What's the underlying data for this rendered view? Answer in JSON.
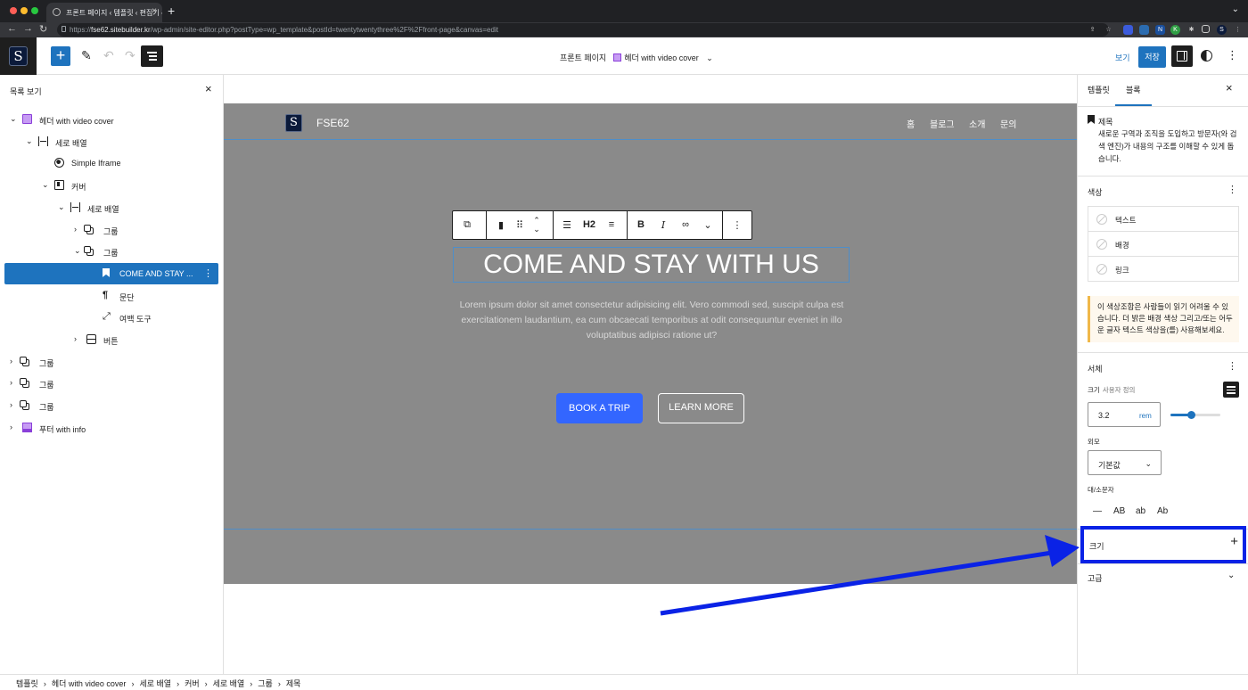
{
  "browser": {
    "tab_title": "프론트 페이지 ‹ 템플릿 ‹ 편집기 ‹ F",
    "url_prefix": "https://",
    "url_host": "fse62.sitebuilder.kr",
    "url_path": "/wp-admin/site-editor.php?postType=wp_template&postId=twentytwentythree%2F%2Ffront-page&canvas=edit"
  },
  "topbar": {
    "logo_letter": "S",
    "doc_title": "프론트 페이지",
    "template_name": "헤더 with video cover",
    "view_label": "보기",
    "save_label": "저장"
  },
  "list_view": {
    "title": "목록 보기",
    "items": [
      {
        "label": "헤더 with video cover",
        "indent": 0,
        "chevron": "⌄",
        "icon": "template"
      },
      {
        "label": "세로 배열",
        "indent": 1,
        "chevron": "⌄",
        "icon": "stack"
      },
      {
        "label": "Simple Iframe",
        "indent": 2,
        "chevron": "",
        "icon": "globe"
      },
      {
        "label": "커버",
        "indent": 2,
        "chevron": "⌄",
        "icon": "cover"
      },
      {
        "label": "세로 배열",
        "indent": 3,
        "chevron": "⌄",
        "icon": "stack"
      },
      {
        "label": "그룹",
        "indent": 4,
        "chevron": "›",
        "icon": "group"
      },
      {
        "label": "그룹",
        "indent": 4,
        "chevron": "⌄",
        "icon": "group"
      },
      {
        "label": "COME AND STAY ...",
        "indent": 5,
        "chevron": "",
        "icon": "bookmark",
        "selected": true
      },
      {
        "label": "문단",
        "indent": 5,
        "chevron": "",
        "icon": "paragraph"
      },
      {
        "label": "여백 도구",
        "indent": 5,
        "chevron": "",
        "icon": "spacer"
      },
      {
        "label": "버튼",
        "indent": 4,
        "chevron": "›",
        "icon": "buttons"
      },
      {
        "label": "그룹",
        "indent": 0,
        "chevron": "›",
        "icon": "group"
      },
      {
        "label": "그룹",
        "indent": 0,
        "chevron": "›",
        "icon": "group"
      },
      {
        "label": "그룹",
        "indent": 0,
        "chevron": "›",
        "icon": "group"
      },
      {
        "label": "푸터 with info",
        "indent": 0,
        "chevron": "›",
        "icon": "footer"
      }
    ]
  },
  "canvas": {
    "site_logo": "S",
    "site_title": "FSE62",
    "nav": [
      "홈",
      "블로그",
      "소개",
      "문의"
    ],
    "heading_level": "H2",
    "heading": "COME AND STAY WITH US",
    "paragraph": "Lorem ipsum dolor sit amet consectetur adipisicing elit. Vero commodi sed, suscipit culpa est exercitationem laudantium, ea cum obcaecati temporibus at odit consequuntur eveniet in illo voluptatibus adipisci ratione ut?",
    "button_primary": "BOOK A TRIP",
    "button_secondary": "LEARN MORE"
  },
  "settings": {
    "tab_template": "템플릿",
    "tab_block": "블록",
    "block_name": "제목",
    "block_description": "새로운 구역과 조직을 도입하고 방문자(와 검색 엔진)가 내용의 구조를 이해할 수 있게 돕습니다.",
    "color_title": "색상",
    "colors": [
      "텍스트",
      "배경",
      "링크"
    ],
    "contrast_warning": "이 색상조합은 사람들이 읽기 어려울 수 있습니다. 더 밝은 배경 색상 그리고/또는 어두운 글자 텍스트 색상을(를) 사용해보세요.",
    "typography_title": "서체",
    "size_label": "크기",
    "size_custom": "사용자 정의",
    "size_value": "3.2",
    "size_unit": "rem",
    "size_slider_fraction": 0.42,
    "appearance_label": "외모",
    "appearance_value": "기본값",
    "lettercase_label": "대/소문자",
    "lettercase": [
      "—",
      "AB",
      "ab",
      "Ab"
    ],
    "dimensions_label": "크기",
    "advanced_label": "고급"
  },
  "breadcrumbs": [
    "템플릿",
    "헤더 with video cover",
    "세로 배열",
    "커버",
    "세로 배열",
    "그룹",
    "제목"
  ],
  "colors": {
    "wp_blue": "#1e73be",
    "annotation_blue": "#0a22e6",
    "cover_gray": "#8a8a8a",
    "cta_blue": "#3366ff"
  }
}
